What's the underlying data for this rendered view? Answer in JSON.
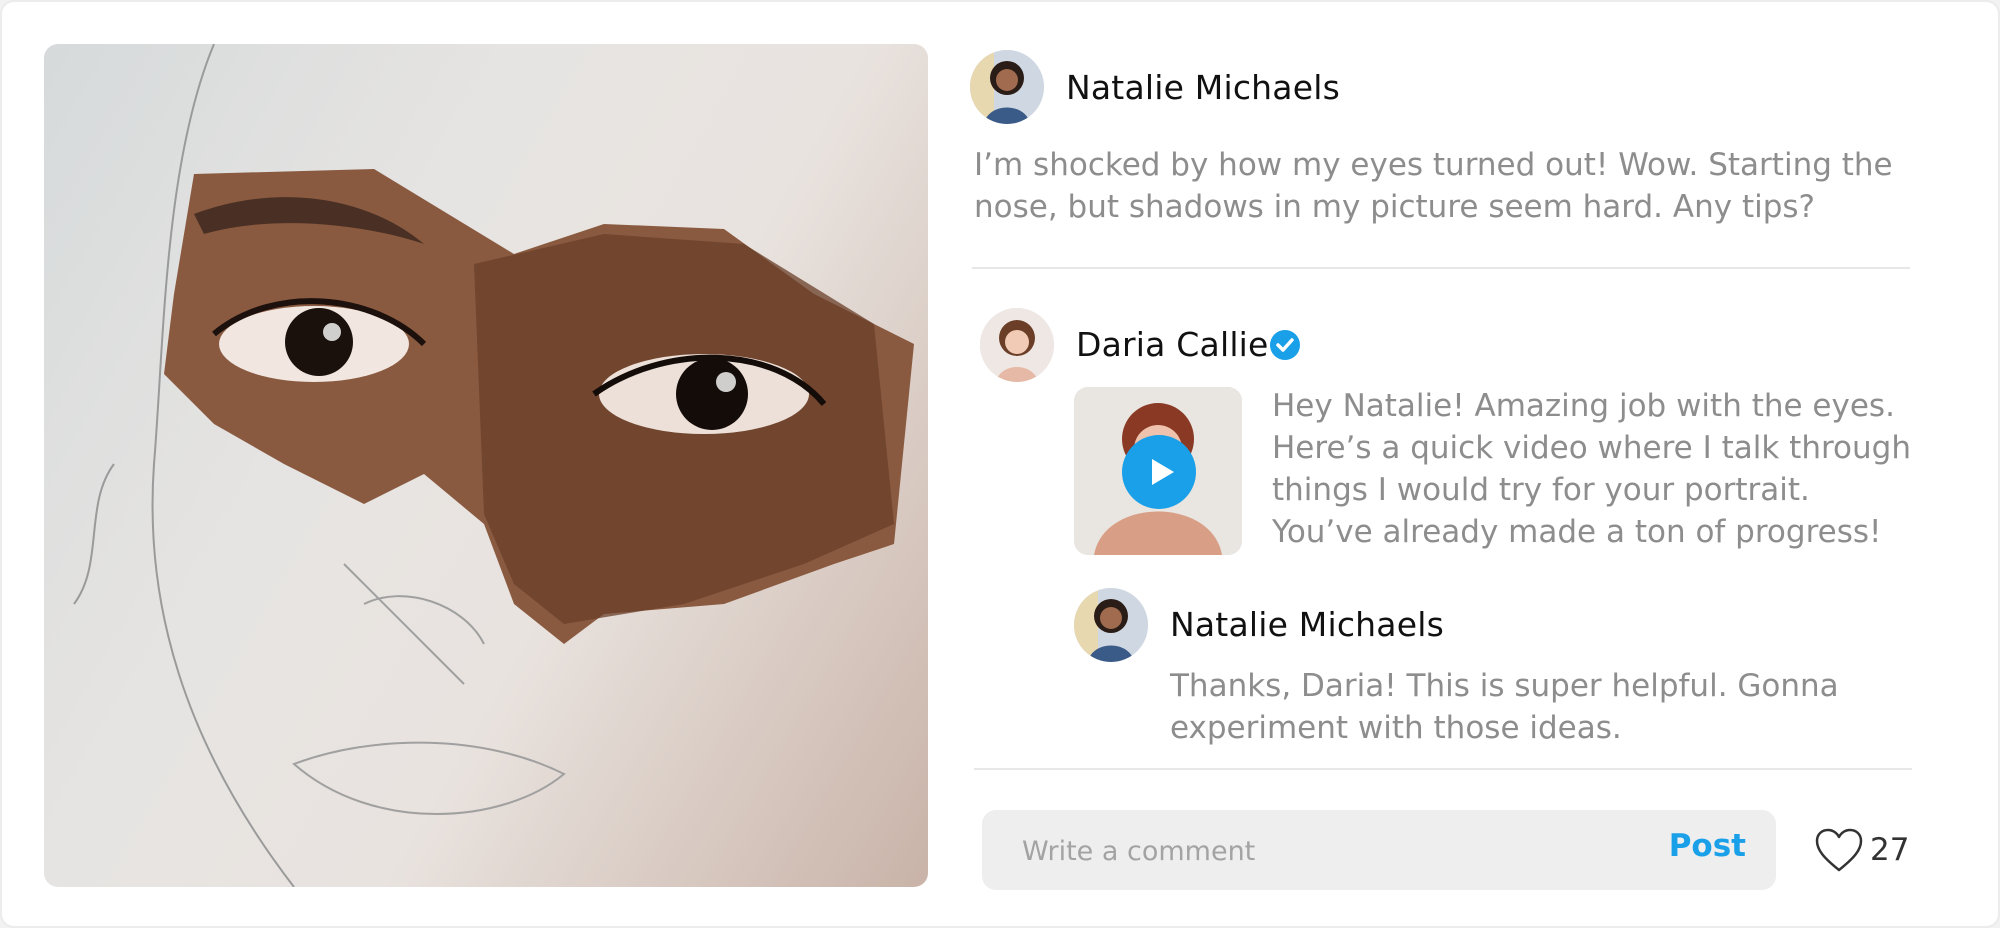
{
  "post": {
    "author": "Natalie Michaels",
    "text": "I’m shocked by how my eyes turned out! Wow. Starting the nose, but shadows in my picture seem hard. Any tips?"
  },
  "reply": {
    "author": "Daria Callie",
    "verified": true,
    "text": "Hey Natalie! Amazing job with the eyes. Here’s a quick video where I talk through things I would try for your portrait. You’ve already made a ton of progress!"
  },
  "sub_reply": {
    "author": "Natalie Michaels",
    "text": "Thanks, Daria! This is super helpful. Gonna experiment with those ideas."
  },
  "composer": {
    "placeholder": "Write a comment",
    "post_label": "Post"
  },
  "likes": {
    "count": "27"
  },
  "colors": {
    "accent": "#1aa0e8",
    "muted_text": "#8d8d8d"
  },
  "icons": {
    "like": "heart-outline-icon",
    "verified": "check-badge-icon",
    "play": "play-icon"
  }
}
